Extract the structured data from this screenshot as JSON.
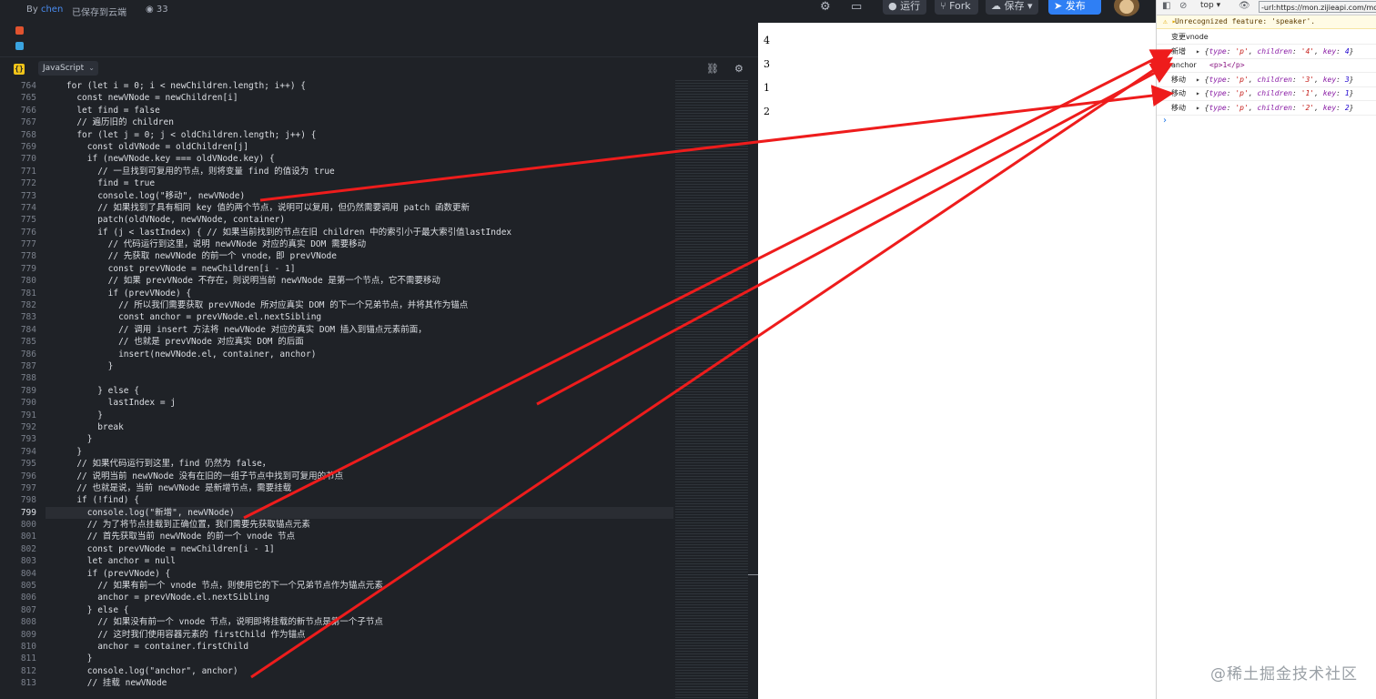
{
  "header": {
    "by_label": "By",
    "author": "chen",
    "saved_status": "已保存到云端",
    "views": "33",
    "run_label": "运行",
    "fork_label": "Fork",
    "save_label": "保存",
    "publish_label": "发布"
  },
  "editor": {
    "language": "JavaScript",
    "active_line": 799,
    "line_numbers": [
      764,
      765,
      766,
      767,
      768,
      769,
      770,
      771,
      772,
      773,
      774,
      775,
      776,
      777,
      778,
      779,
      780,
      781,
      782,
      783,
      784,
      785,
      786,
      787,
      788,
      789,
      790,
      791,
      792,
      793,
      794,
      795,
      796,
      797,
      798,
      799,
      800,
      801,
      802,
      803,
      804,
      805,
      806,
      807,
      808,
      809,
      810,
      811,
      812,
      813
    ],
    "code_lines": [
      "    for (let i = 0; i < newChildren.length; i++) {",
      "      const newVNode = newChildren[i]",
      "      let find = false",
      "      // 遍历旧的 children",
      "      for (let j = 0; j < oldChildren.length; j++) {",
      "        const oldVNode = oldChildren[j]",
      "        if (newVNode.key === oldVNode.key) {",
      "          // 一旦找到可复用的节点，则将变量 find 的值设为 true",
      "          find = true",
      "          console.log(\"移动\", newVNode)",
      "          // 如果找到了具有相同 key 值的两个节点，说明可以复用，但仍然需要调用 patch 函数更新",
      "          patch(oldVNode, newVNode, container)",
      "          if (j < lastIndex) { // 如果当前找到的节点在旧 children 中的索引小于最大索引值lastIndex",
      "            // 代码运行到这里，说明 newVNode 对应的真实 DOM 需要移动",
      "            // 先获取 newVNode 的前一个 vnode，即 prevVNode",
      "            const prevVNode = newChildren[i - 1]",
      "            // 如果 prevVNode 不存在，则说明当前 newVNode 是第一个节点，它不需要移动",
      "            if (prevVNode) {",
      "              // 所以我们需要获取 prevVNode 所对应真实 DOM 的下一个兄弟节点，并将其作为锚点",
      "              const anchor = prevVNode.el.nextSibling",
      "              // 调用 insert 方法将 newVNode 对应的真实 DOM 插入到锚点元素前面，",
      "              // 也就是 prevVNode 对应真实 DOM 的后面",
      "              insert(newVNode.el, container, anchor)",
      "            }",
      "",
      "          } else {",
      "            lastIndex = j",
      "          }",
      "          break",
      "        }",
      "      }",
      "      // 如果代码运行到这里，find 仍然为 false，",
      "      // 说明当前 newVNode 没有在旧的一组子节点中找到可复用的节点",
      "      // 也就是说，当前 newVNode 是新增节点，需要挂载",
      "      if (!find) {",
      "        console.log(\"新增\", newVNode)",
      "        // 为了将节点挂载到正确位置，我们需要先获取锚点元素",
      "        // 首先获取当前 newVNode 的前一个 vnode 节点",
      "        const prevVNode = newChildren[i - 1]",
      "        let anchor = null",
      "        if (prevVNode) {",
      "          // 如果有前一个 vnode 节点，则使用它的下一个兄弟节点作为锚点元素",
      "          anchor = prevVNode.el.nextSibling",
      "        } else {",
      "          // 如果没有前一个 vnode 节点，说明即将挂载的新节点是第一个子节点",
      "          // 这时我们使用容器元素的 firstChild 作为锚点",
      "          anchor = container.firstChild",
      "        }",
      "        console.log(\"anchor\", anchor)",
      "        // 挂载 newVNode"
    ]
  },
  "preview": {
    "items": [
      "4",
      "3",
      "1",
      "2"
    ]
  },
  "devtools": {
    "context": "top",
    "filter_value": "-url:https://mon.zijieapi.com/monitor",
    "warning": "Unrecognized feature: 'speaker'.",
    "logs": [
      {
        "label": "变更vnode",
        "value": ""
      },
      {
        "label": "新增",
        "value": "{type: 'p', children: '4', key: 4}"
      },
      {
        "label": "anchor",
        "value": "<p>1</p>"
      },
      {
        "label": "移动",
        "value": "{type: 'p', children: '3', key: 3}"
      },
      {
        "label": "移动",
        "value": "{type: 'p', children: '1', key: 1}"
      },
      {
        "label": "移动",
        "value": "{type: 'p', children: '2', key: 2}"
      }
    ],
    "prompt": "›"
  },
  "watermark": "@稀土掘金技术社区",
  "colors": {
    "editor_bg": "#1f2227",
    "arrow": "#ee1c1c",
    "publish_btn": "#2f7ff4"
  }
}
